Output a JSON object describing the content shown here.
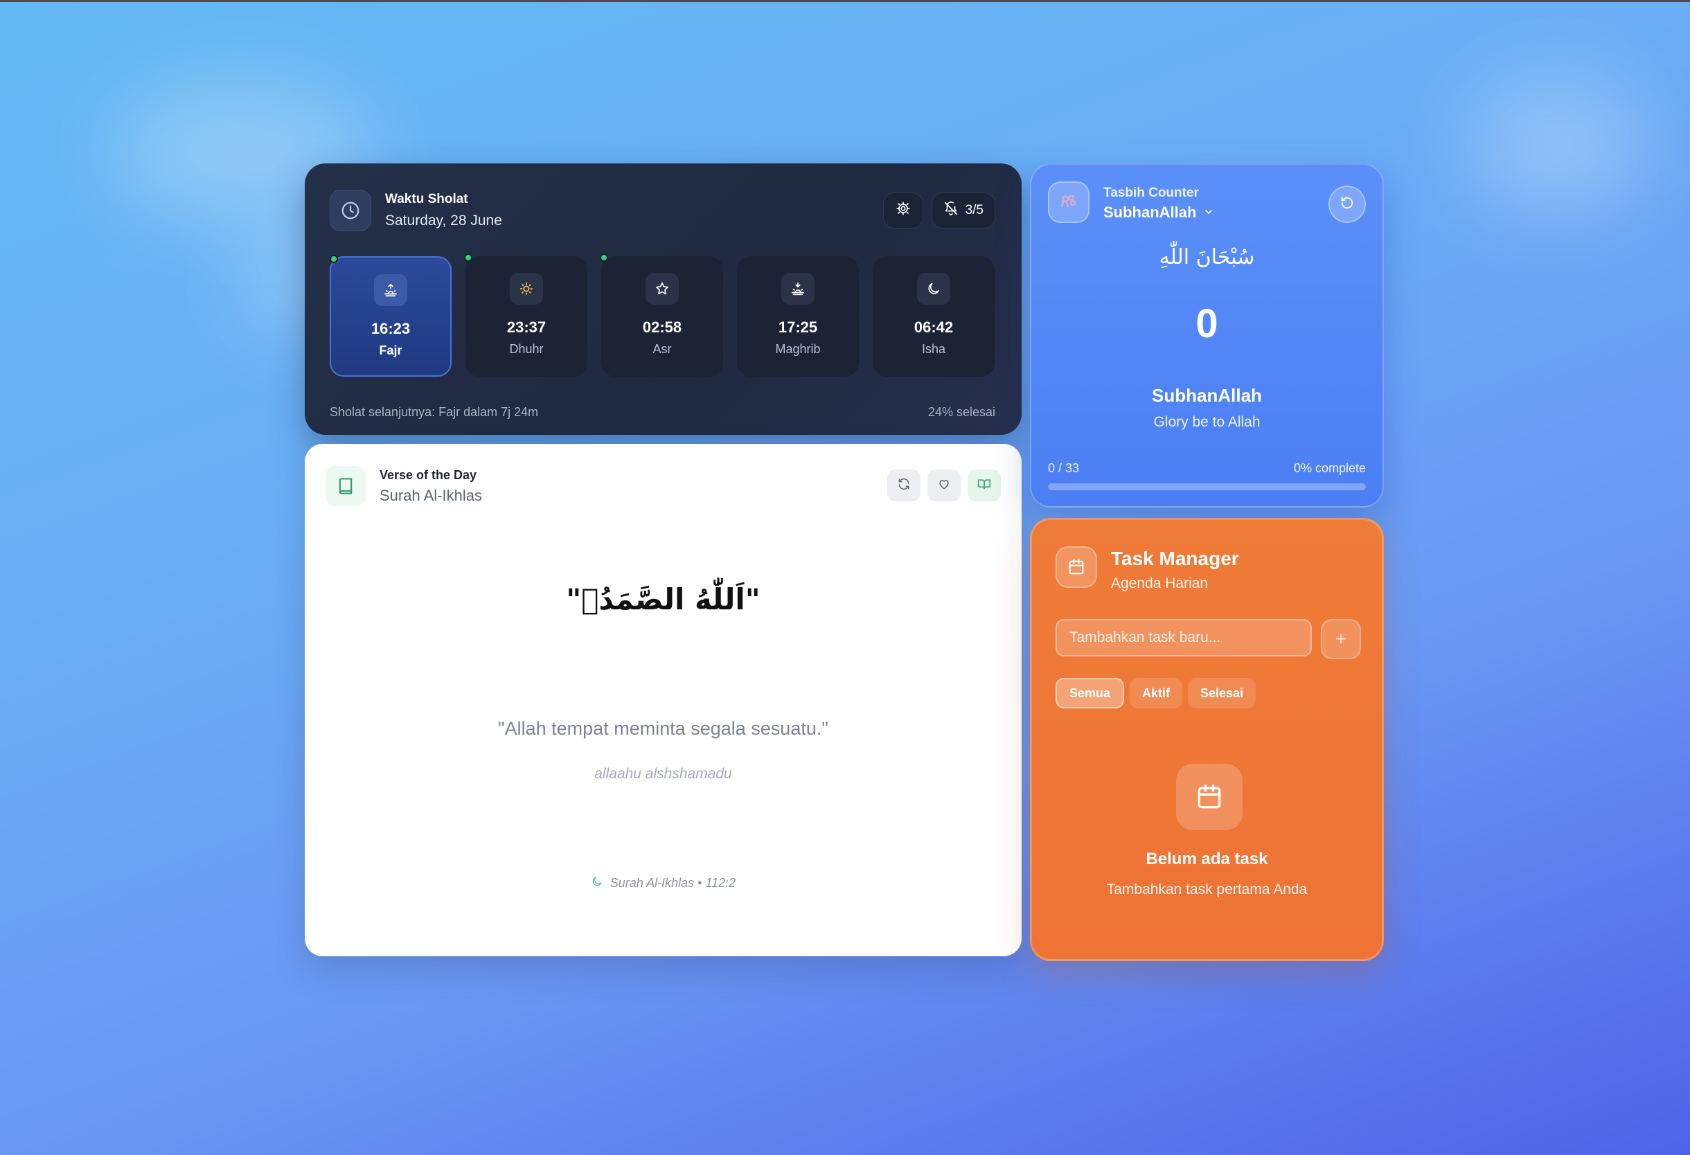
{
  "prayer": {
    "label": "Waktu Sholat",
    "date": "Saturday, 28 June",
    "notif_count": "3/5",
    "slots": [
      {
        "time": "16:23",
        "name": "Fajr",
        "icon": "sunrise-icon",
        "active": true,
        "dot": true
      },
      {
        "time": "23:37",
        "name": "Dhuhr",
        "icon": "sun-icon",
        "active": false,
        "dot": true
      },
      {
        "time": "02:58",
        "name": "Asr",
        "icon": "star-icon",
        "active": false,
        "dot": true
      },
      {
        "time": "17:25",
        "name": "Maghrib",
        "icon": "sunset-icon",
        "active": false,
        "dot": false
      },
      {
        "time": "06:42",
        "name": "Isha",
        "icon": "moon-icon",
        "active": false,
        "dot": false
      }
    ],
    "next_prayer": "Sholat selanjutnya: Fajr dalam 7j 24m",
    "progress": "24% selesai"
  },
  "verse": {
    "label": "Verse of the Day",
    "surah": "Surah Al-Ikhlas",
    "arabic": "\"اَللّٰهُ الصَّمَدُۚ\"",
    "translation": "\"Allah tempat meminta segala sesuatu.\"",
    "transliteration": "allaahu alshshamadu",
    "reference": "Surah Al-Ikhlas • 112:2"
  },
  "tasbih": {
    "label": "Tasbih Counter",
    "selected": "SubhanAllah",
    "arabic": "سُبْحَانَ اللّٰهِ",
    "count": "0",
    "name": "SubhanAllah",
    "meaning": "Glory be to Allah",
    "progress_text": "0 / 33",
    "complete_text": "0% complete",
    "progress_fraction": 0
  },
  "tasks": {
    "title": "Task Manager",
    "subtitle": "Agenda Harian",
    "input_placeholder": "Tambahkan task baru...",
    "add_label": "+",
    "filters": [
      "Semua",
      "Aktif",
      "Selesai"
    ],
    "active_filter": "Semua",
    "empty_title": "Belum ada task",
    "empty_sub": "Tambahkan task pertama Anda"
  },
  "colors": {
    "accent_green": "#39d07a",
    "tasbih_blue": "#4b7ff4",
    "task_orange": "#ee7335"
  }
}
